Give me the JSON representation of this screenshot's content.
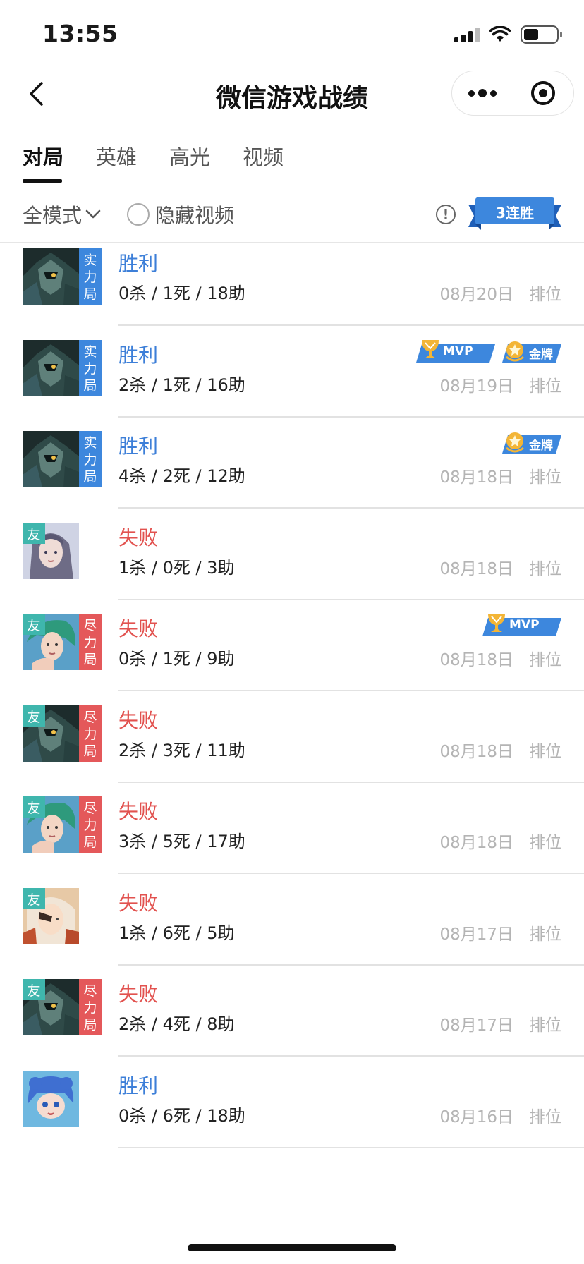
{
  "status_bar": {
    "time": "13:55"
  },
  "nav": {
    "title": "微信游戏战绩"
  },
  "tabs": [
    {
      "label": "对局",
      "active": true
    },
    {
      "label": "英雄",
      "active": false
    },
    {
      "label": "高光",
      "active": false
    },
    {
      "label": "视频",
      "active": false
    }
  ],
  "filter": {
    "mode_label": "全模式",
    "hide_video_label": "隐藏视频",
    "streak_label": "3连胜"
  },
  "medal_labels": {
    "mvp": "MVP",
    "gold": "金牌"
  },
  "matches": [
    {
      "result": "胜利",
      "outcome": "win",
      "kda": "0杀 / 1死 / 18助",
      "date": "08月20日",
      "mode": "排位",
      "hero": "dark-knight",
      "friend": false,
      "tag": "实力局",
      "tag_color": "blue",
      "medals": []
    },
    {
      "result": "胜利",
      "outcome": "win",
      "kda": "2杀 / 1死 / 16助",
      "date": "08月19日",
      "mode": "排位",
      "hero": "dark-knight",
      "friend": false,
      "tag": "实力局",
      "tag_color": "blue",
      "medals": [
        "mvp",
        "gold"
      ]
    },
    {
      "result": "胜利",
      "outcome": "win",
      "kda": "4杀 / 2死 / 12助",
      "date": "08月18日",
      "mode": "排位",
      "hero": "dark-knight",
      "friend": false,
      "tag": "实力局",
      "tag_color": "blue",
      "medals": [
        "gold"
      ]
    },
    {
      "result": "失败",
      "outcome": "lose",
      "kda": "1杀 / 0死 / 3助",
      "date": "08月18日",
      "mode": "排位",
      "hero": "silver-lady",
      "friend": true,
      "tag": "",
      "tag_color": "",
      "medals": []
    },
    {
      "result": "失败",
      "outcome": "lose",
      "kda": "0杀 / 1死 / 9助",
      "date": "08月18日",
      "mode": "排位",
      "hero": "green-hair",
      "friend": true,
      "tag": "尽力局",
      "tag_color": "red",
      "medals": [
        "mvp"
      ]
    },
    {
      "result": "失败",
      "outcome": "lose",
      "kda": "2杀 / 3死 / 11助",
      "date": "08月18日",
      "mode": "排位",
      "hero": "dark-knight",
      "friend": true,
      "tag": "尽力局",
      "tag_color": "red",
      "medals": []
    },
    {
      "result": "失败",
      "outcome": "lose",
      "kda": "3杀 / 5死 / 17助",
      "date": "08月18日",
      "mode": "排位",
      "hero": "green-hair",
      "friend": true,
      "tag": "尽力局",
      "tag_color": "red",
      "medals": []
    },
    {
      "result": "失败",
      "outcome": "lose",
      "kda": "1杀 / 6死 / 5助",
      "date": "08月17日",
      "mode": "排位",
      "hero": "eyepatch",
      "friend": true,
      "tag": "",
      "tag_color": "",
      "medals": []
    },
    {
      "result": "失败",
      "outcome": "lose",
      "kda": "2杀 / 4死 / 8助",
      "date": "08月17日",
      "mode": "排位",
      "hero": "dark-knight",
      "friend": true,
      "tag": "尽力局",
      "tag_color": "red",
      "medals": []
    },
    {
      "result": "胜利",
      "outcome": "win",
      "kda": "0杀 / 6死 / 18助",
      "date": "08月16日",
      "mode": "排位",
      "hero": "blue-girl",
      "friend": false,
      "tag": "",
      "tag_color": "",
      "medals": []
    }
  ],
  "friend_badge": "友",
  "colors": {
    "win": "#3d7fd8",
    "lose": "#e2524f",
    "tag_blue": "#3d87dd",
    "tag_red": "#e4585a",
    "friend": "#3fb6ad"
  }
}
